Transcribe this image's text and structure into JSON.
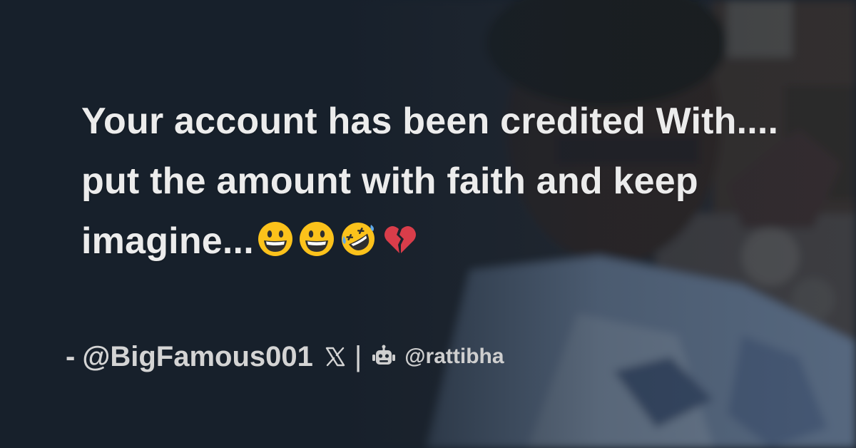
{
  "tweet": {
    "text": "Your account has been credited With.... put the amount with faith and keep imagine...",
    "emojis": [
      "grinning-face-emoji",
      "grinning-face-emoji",
      "rolling-on-floor-laughing-emoji",
      "broken-heart-emoji"
    ]
  },
  "footer": {
    "dash": "-",
    "author_handle": "@BigFamous001",
    "platform_icon": "x-logo-icon",
    "separator": "|",
    "brand_icon": "robot-icon",
    "brand_handle": "@rattibha"
  },
  "colors": {
    "background": "#18212d",
    "text": "#ececec",
    "footer_text": "#d4d4d4"
  }
}
